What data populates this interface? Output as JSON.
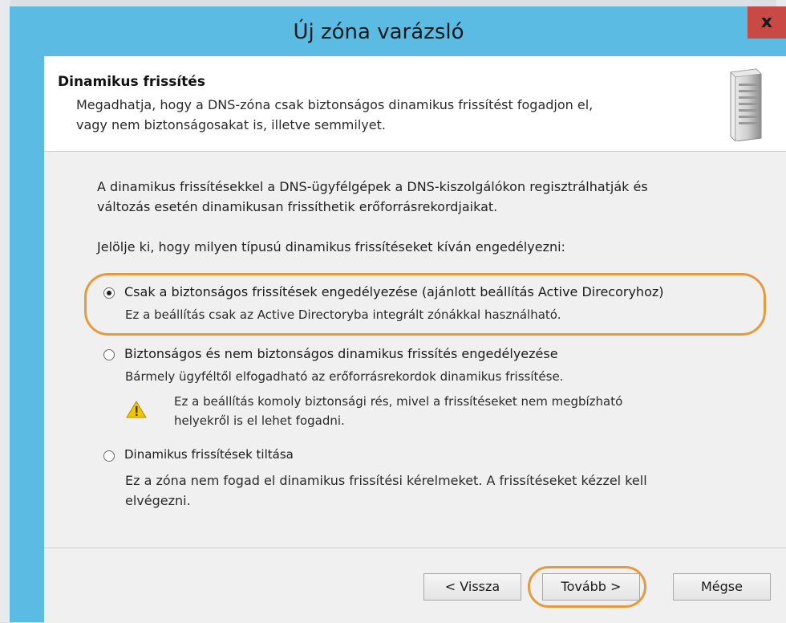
{
  "window": {
    "title": "Új zóna varázsló",
    "close_label": "x"
  },
  "header": {
    "title": "Dinamikus frissítés",
    "description_line1": "Megadhatja, hogy a DNS-zóna csak biztonságos dinamikus frissítést fogadjon el,",
    "description_line2": "vagy nem biztonságosakat is, illetve semmilyet."
  },
  "body": {
    "intro_line1": "A dinamikus frissítésekkel a DNS-ügyfélgépek a DNS-kiszolgálókon regisztrálhatják és",
    "intro_line2": "változás esetén dinamikusan frissíthetik erőforrásrekordjaikat.",
    "prompt": "Jelölje ki, hogy milyen típusú dinamikus frissítéseket kíván engedélyezni:"
  },
  "options": [
    {
      "label": "Csak a biztonságos frissítések engedélyezése (ajánlott beállítás Active Direcoryhoz)",
      "desc_line1": "Ez a beállítás csak az Active Directoryba integrált zónákkal használható.",
      "selected": true
    },
    {
      "label": "Biztonságos és nem biztonságos dinamikus frissítés engedélyezése",
      "desc_line1": "Bármely ügyféltől elfogadható az erőforrásrekordok dinamikus frissítése.",
      "warning_line1": "Ez a beállítás komoly biztonsági rés, mivel a frissítéseket nem megbízható",
      "warning_line2": "helyekről is el lehet fogadni.",
      "selected": false
    },
    {
      "label": "Dinamikus frissítések tiltása",
      "desc_line1": "Ez a zóna nem fogad el dinamikus frissítési kérelmeket. A frissítéseket kézzel kell",
      "desc_line2": "elvégezni.",
      "selected": false
    }
  ],
  "buttons": {
    "back": "< Vissza",
    "next": "Tovább >",
    "cancel": "Mégse"
  },
  "colors": {
    "titlebar": "#5bbbe3",
    "close": "#c94a45",
    "highlight": "#e59a3e",
    "warning": "#f2c500"
  },
  "icons": {
    "header": "server-icon",
    "warning": "warning-icon"
  }
}
